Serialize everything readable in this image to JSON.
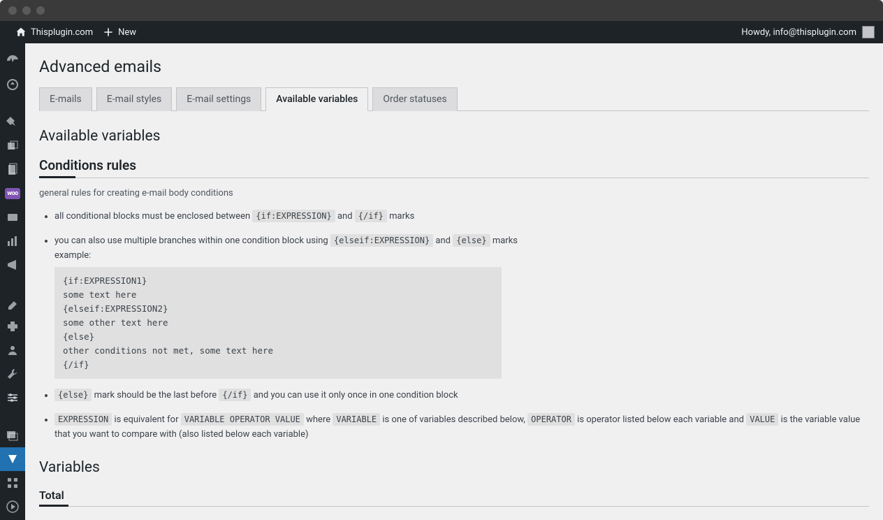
{
  "adminbar": {
    "site_name": "Thisplugin.com",
    "new_label": "New",
    "howdy": "Howdy, info@thisplugin.com"
  },
  "page": {
    "title": "Advanced emails",
    "section_title": "Available variables",
    "conditions_title": "Conditions rules",
    "conditions_sub": "general rules for creating e-mail body conditions",
    "variables_title": "Variables",
    "var_sub_total": "Total"
  },
  "tabs": [
    {
      "label": "E-mails"
    },
    {
      "label": "E-mail styles"
    },
    {
      "label": "E-mail settings"
    },
    {
      "label": "Available variables",
      "active": true
    },
    {
      "label": "Order statuses"
    }
  ],
  "rules": {
    "r1_a": "all conditional blocks must be enclosed between ",
    "r1_c1": "{if:EXPRESSION}",
    "r1_b": " and ",
    "r1_c2": "{/if}",
    "r1_c": " marks",
    "r2_a": "you can also use multiple branches within one condition block using ",
    "r2_c1": "{elseif:EXPRESSION}",
    "r2_b": " and ",
    "r2_c2": "{else}",
    "r2_c": " marks",
    "r2_ex": "example:",
    "r2_block": "{if:EXPRESSION1}\nsome text here\n{elseif:EXPRESSION2}\nsome other text here\n{else}\nother conditions not met, some text here\n{/if}",
    "r3_c1": "{else}",
    "r3_a": " mark should be the last before ",
    "r3_c2": "{/if}",
    "r3_b": " and you can use it only once in one condition block",
    "r4_c1": "EXPRESSION",
    "r4_a": " is equivalent for ",
    "r4_c2": "VARIABLE OPERATOR VALUE",
    "r4_b": " where ",
    "r4_c3": "VARIABLE",
    "r4_c": " is one of variables described below, ",
    "r4_c4": "OPERATOR",
    "r4_d": " is operator listed below each variable and ",
    "r4_c5": "VALUE",
    "r4_e": " is the variable value that you want to compare with (also listed below each variable)"
  }
}
